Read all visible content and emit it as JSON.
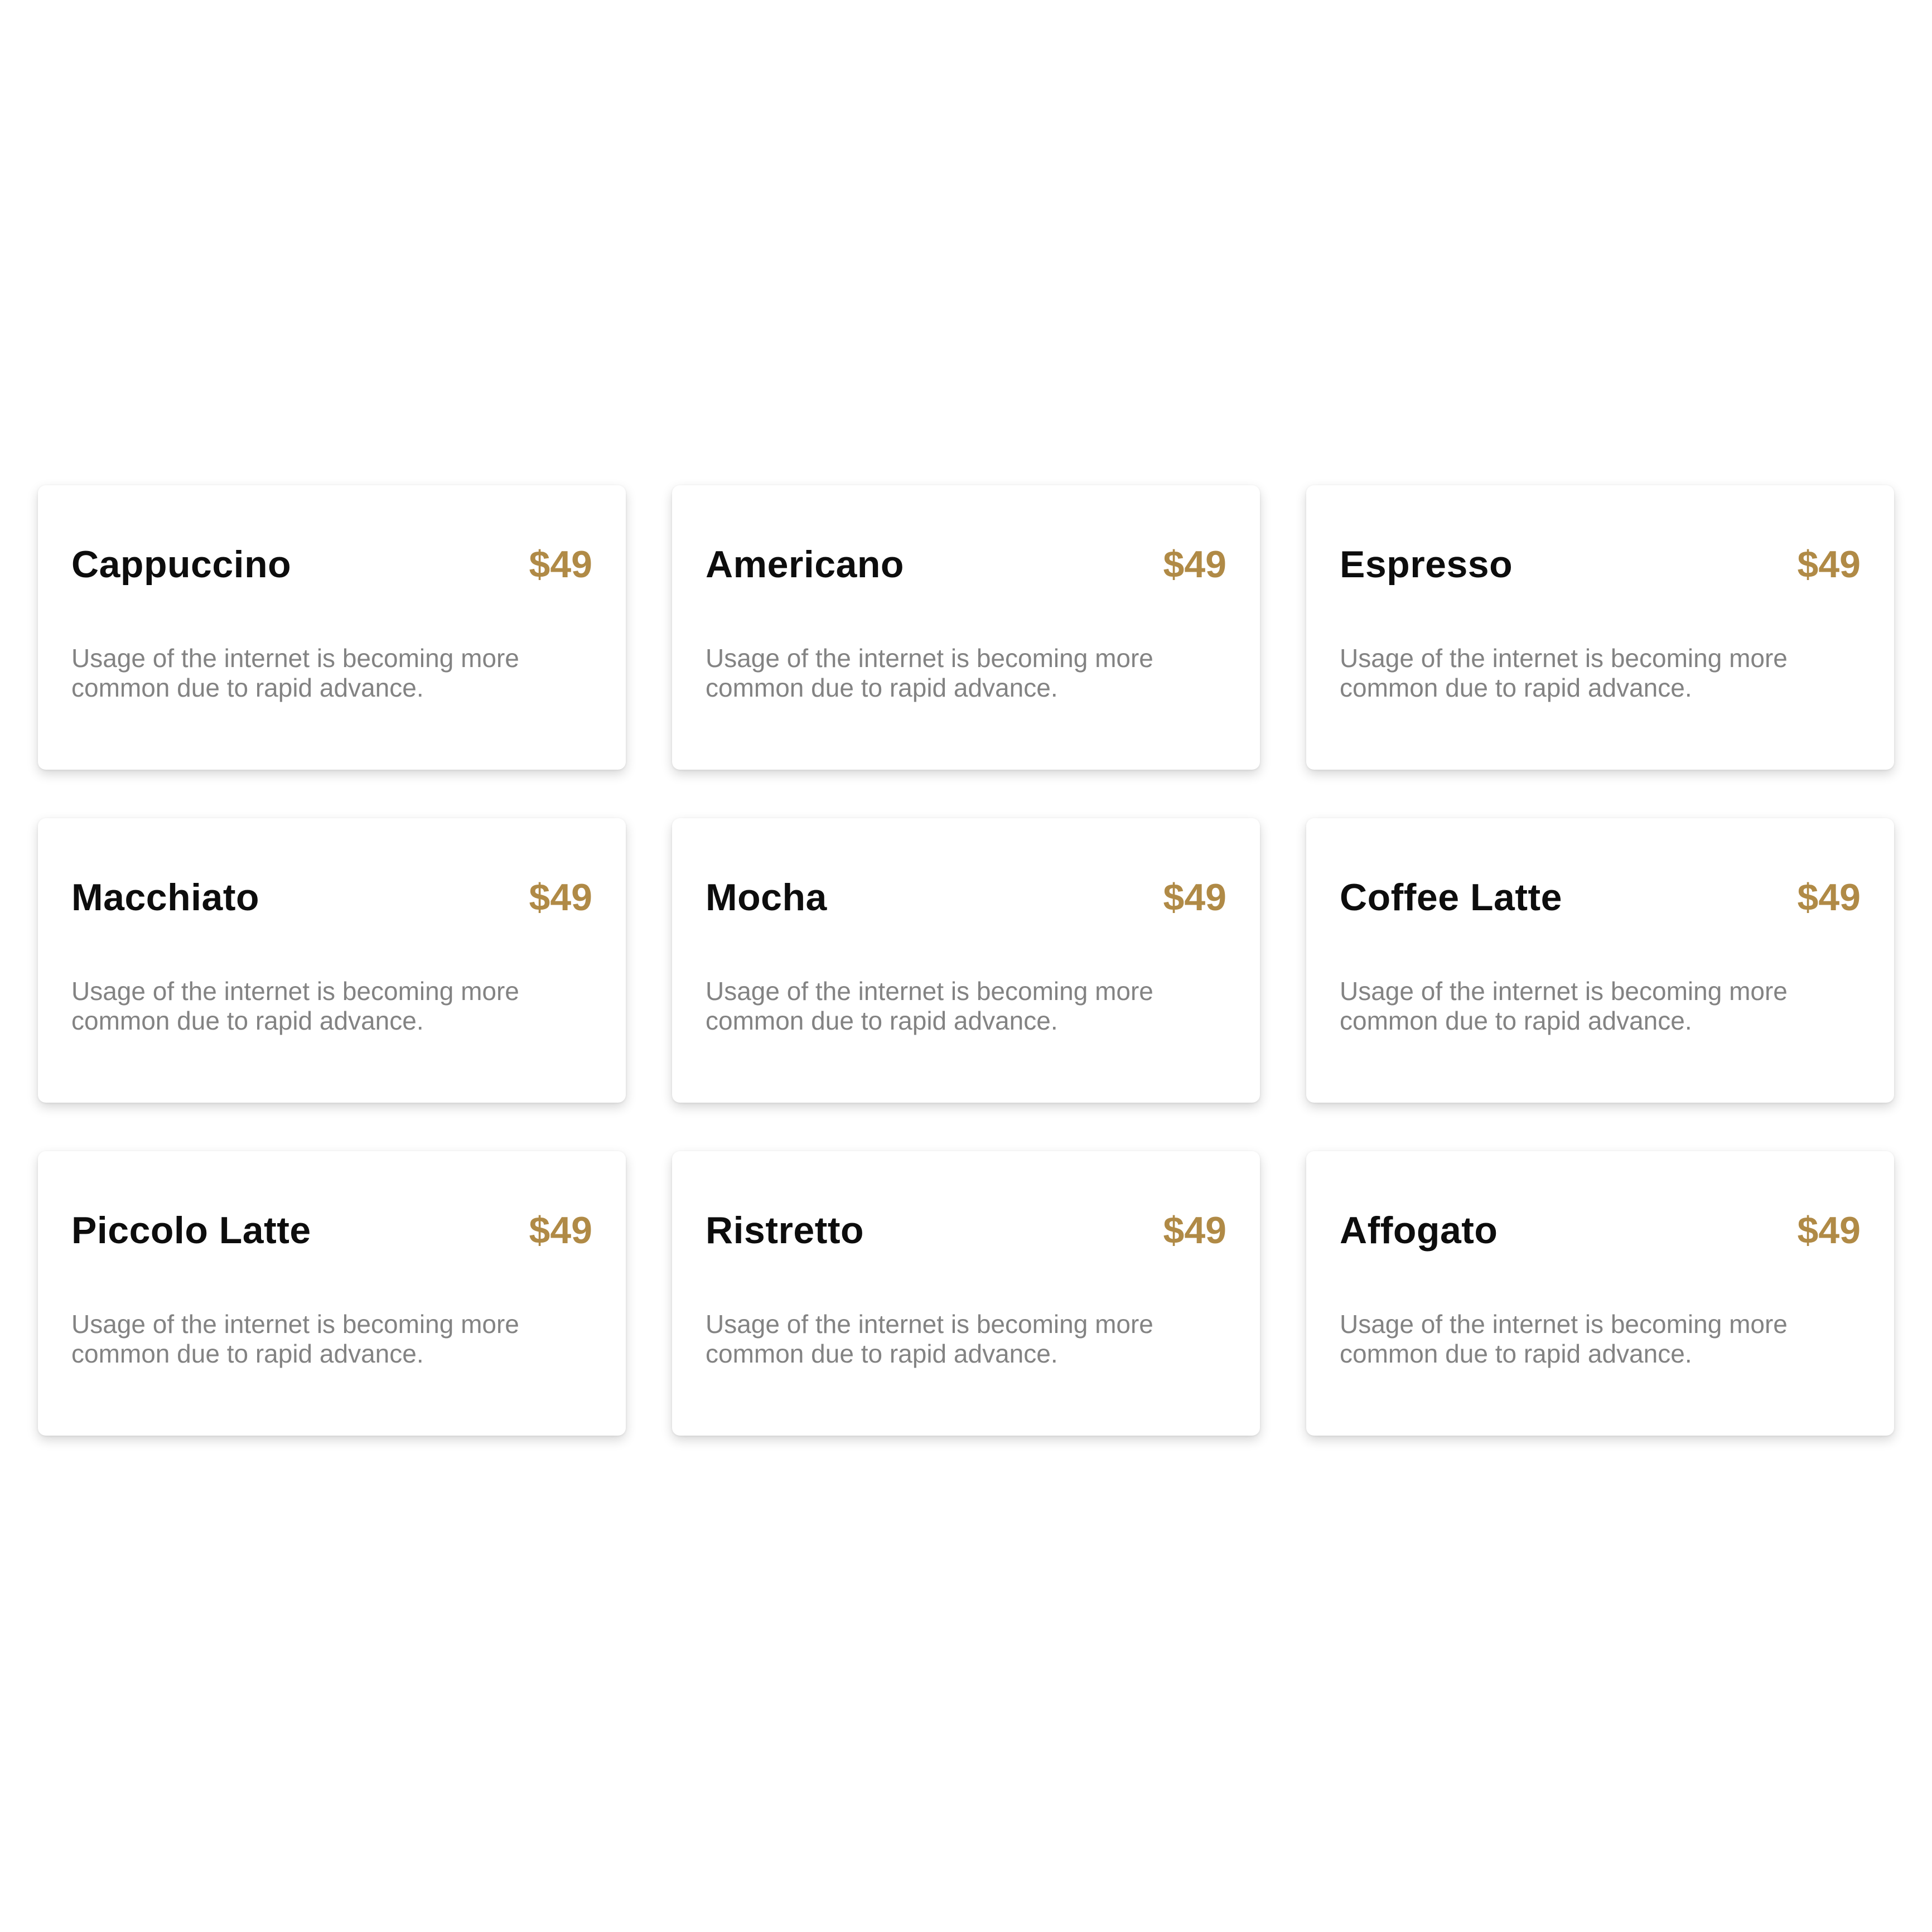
{
  "colors": {
    "price": "#b08a46",
    "name": "#0d0d0d",
    "description": "#838383",
    "background": "#ffffff"
  },
  "menu": {
    "items": [
      {
        "name": "Cappuccino",
        "price": "$49",
        "description": "Usage of the internet is becoming more common due to rapid advance."
      },
      {
        "name": "Americano",
        "price": "$49",
        "description": "Usage of the internet is becoming more common due to rapid advance."
      },
      {
        "name": "Espresso",
        "price": "$49",
        "description": "Usage of the internet is becoming more common due to rapid advance."
      },
      {
        "name": "Macchiato",
        "price": "$49",
        "description": "Usage of the internet is becoming more common due to rapid advance."
      },
      {
        "name": "Mocha",
        "price": "$49",
        "description": "Usage of the internet is becoming more common due to rapid advance."
      },
      {
        "name": "Coffee Latte",
        "price": "$49",
        "description": "Usage of the internet is becoming more common due to rapid advance."
      },
      {
        "name": "Piccolo Latte",
        "price": "$49",
        "description": "Usage of the internet is becoming more common due to rapid advance."
      },
      {
        "name": "Ristretto",
        "price": "$49",
        "description": "Usage of the internet is becoming more common due to rapid advance."
      },
      {
        "name": "Affogato",
        "price": "$49",
        "description": "Usage of the internet is becoming more common due to rapid advance."
      }
    ]
  }
}
